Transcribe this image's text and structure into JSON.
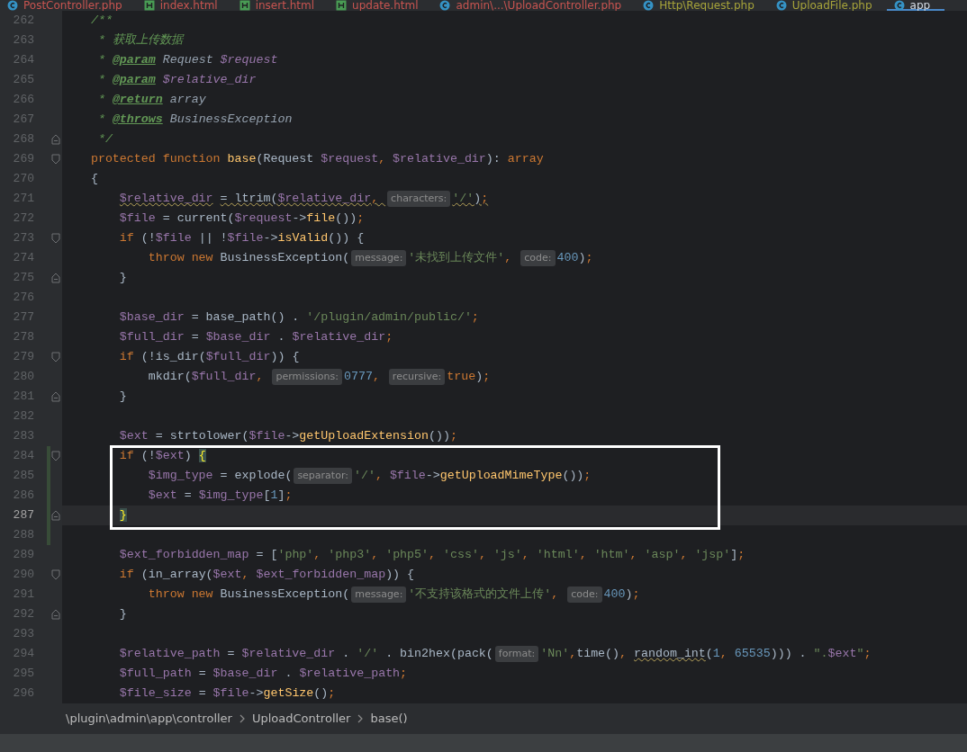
{
  "tabs": [
    {
      "label": "PostController.php",
      "kind": "php",
      "color": "#c75450",
      "selected": false
    },
    {
      "label": "index.html",
      "kind": "html",
      "color": "#c75450",
      "selected": false
    },
    {
      "label": "insert.html",
      "kind": "html",
      "color": "#c75450",
      "selected": false
    },
    {
      "label": "update.html",
      "kind": "html",
      "color": "#c75450",
      "selected": false
    },
    {
      "label": "admin\\...\\UploadController.php",
      "kind": "php",
      "color": "#c75450",
      "selected": false
    },
    {
      "label": "Http\\Request.php",
      "kind": "php",
      "color": "#a6a33a",
      "selected": false
    },
    {
      "label": "UploadFile.php",
      "kind": "php",
      "color": "#a6a33a",
      "selected": false
    },
    {
      "label": "app",
      "kind": "php",
      "color": "#d6dde6",
      "selected": true
    }
  ],
  "editor": {
    "lines": [
      {
        "number": "262",
        "tokens": [
          {
            "kind": "doc",
            "text": "    /**"
          }
        ]
      },
      {
        "number": "263",
        "tokens": [
          {
            "kind": "doc",
            "text": "     * 获取上传数据"
          }
        ]
      },
      {
        "number": "264",
        "tokens": [
          {
            "kind": "doc",
            "text": "     * "
          },
          {
            "kind": "tag",
            "text": "@param"
          },
          {
            "kind": "doctype",
            "text": " Request "
          },
          {
            "kind": "docvar",
            "text": "$request"
          }
        ]
      },
      {
        "number": "265",
        "tokens": [
          {
            "kind": "doc",
            "text": "     * "
          },
          {
            "kind": "tag",
            "text": "@param"
          },
          {
            "kind": "docvar",
            "text": " $relative_dir"
          }
        ]
      },
      {
        "number": "266",
        "tokens": [
          {
            "kind": "doc",
            "text": "     * "
          },
          {
            "kind": "tag",
            "text": "@return"
          },
          {
            "kind": "doctype",
            "text": " array"
          }
        ]
      },
      {
        "number": "267",
        "tokens": [
          {
            "kind": "doc",
            "text": "     * "
          },
          {
            "kind": "tag",
            "text": "@throws"
          },
          {
            "kind": "doctype",
            "text": " BusinessException"
          }
        ]
      },
      {
        "number": "268",
        "fold_end": true,
        "tokens": [
          {
            "kind": "doc",
            "text": "     */"
          }
        ]
      },
      {
        "number": "269",
        "fold_start": true,
        "tokens": [
          {
            "kind": "kw",
            "text": "    protected function "
          },
          {
            "kind": "fn",
            "text": "base"
          },
          {
            "kind": "plain",
            "text": "(Request "
          },
          {
            "kind": "var",
            "text": "$request"
          },
          {
            "kind": "kw",
            "text": ", "
          },
          {
            "kind": "var",
            "text": "$relative_dir"
          },
          {
            "kind": "plain",
            "text": "): "
          },
          {
            "kind": "kw",
            "text": "array"
          }
        ]
      },
      {
        "number": "270",
        "tokens": [
          {
            "kind": "plain",
            "text": "    {"
          }
        ]
      },
      {
        "number": "271",
        "tokens": [
          {
            "kind": "var",
            "text": "        $relative_dir",
            "warning": true
          },
          {
            "kind": "plain",
            "text": " = ltrim(",
            "warning": true
          },
          {
            "kind": "var",
            "text": "$relative_dir",
            "warning": true
          },
          {
            "kind": "kw",
            "text": ", ",
            "warning": true
          },
          {
            "kind": "hint",
            "text": "characters:"
          },
          {
            "kind": "str",
            "text": "'/'",
            "warning": true
          },
          {
            "kind": "plain",
            "text": ")",
            "warning": true
          },
          {
            "kind": "kw",
            "text": ";",
            "warning": true
          }
        ]
      },
      {
        "number": "272",
        "tokens": [
          {
            "kind": "var",
            "text": "        $file"
          },
          {
            "kind": "plain",
            "text": " = current("
          },
          {
            "kind": "var",
            "text": "$request"
          },
          {
            "kind": "plain",
            "text": "->"
          },
          {
            "kind": "fn",
            "text": "file"
          },
          {
            "kind": "plain",
            "text": "())"
          },
          {
            "kind": "kw",
            "text": ";"
          }
        ]
      },
      {
        "number": "273",
        "fold_start": true,
        "tokens": [
          {
            "kind": "kw",
            "text": "        if"
          },
          {
            "kind": "plain",
            "text": " (!"
          },
          {
            "kind": "var",
            "text": "$file"
          },
          {
            "kind": "plain",
            "text": " || !"
          },
          {
            "kind": "var",
            "text": "$file"
          },
          {
            "kind": "plain",
            "text": "->"
          },
          {
            "kind": "fn",
            "text": "isValid"
          },
          {
            "kind": "plain",
            "text": "()) {"
          }
        ]
      },
      {
        "number": "274",
        "tokens": [
          {
            "kind": "kw",
            "text": "            throw new "
          },
          {
            "kind": "plain",
            "text": "BusinessException("
          },
          {
            "kind": "hint",
            "text": "message:"
          },
          {
            "kind": "str",
            "text": "'未找到上传文件'"
          },
          {
            "kind": "kw",
            "text": ", "
          },
          {
            "kind": "hint",
            "text": "code:"
          },
          {
            "kind": "num",
            "text": "400"
          },
          {
            "kind": "plain",
            "text": ")"
          },
          {
            "kind": "kw",
            "text": ";"
          }
        ]
      },
      {
        "number": "275",
        "fold_end": true,
        "tokens": [
          {
            "kind": "plain",
            "text": "        }"
          }
        ]
      },
      {
        "number": "276"
      },
      {
        "number": "277",
        "tokens": [
          {
            "kind": "var",
            "text": "        $base_dir"
          },
          {
            "kind": "plain",
            "text": " = base_path() . "
          },
          {
            "kind": "str",
            "text": "'/plugin/admin/public/'"
          },
          {
            "kind": "kw",
            "text": ";"
          }
        ]
      },
      {
        "number": "278",
        "tokens": [
          {
            "kind": "var",
            "text": "        $full_dir"
          },
          {
            "kind": "plain",
            "text": " = "
          },
          {
            "kind": "var",
            "text": "$base_dir"
          },
          {
            "kind": "plain",
            "text": " . "
          },
          {
            "kind": "var",
            "text": "$relative_dir"
          },
          {
            "kind": "kw",
            "text": ";"
          }
        ]
      },
      {
        "number": "279",
        "fold_start": true,
        "tokens": [
          {
            "kind": "kw",
            "text": "        if"
          },
          {
            "kind": "plain",
            "text": " (!is_dir("
          },
          {
            "kind": "var",
            "text": "$full_dir"
          },
          {
            "kind": "plain",
            "text": ")) {"
          }
        ]
      },
      {
        "number": "280",
        "tokens": [
          {
            "kind": "plain",
            "text": "            mkdir("
          },
          {
            "kind": "var",
            "text": "$full_dir"
          },
          {
            "kind": "kw",
            "text": ", "
          },
          {
            "kind": "hint",
            "text": "permissions:"
          },
          {
            "kind": "num",
            "text": "0777"
          },
          {
            "kind": "kw",
            "text": ", "
          },
          {
            "kind": "hint",
            "text": "recursive:"
          },
          {
            "kind": "kw",
            "text": "true"
          },
          {
            "kind": "plain",
            "text": ")"
          },
          {
            "kind": "kw",
            "text": ";"
          }
        ]
      },
      {
        "number": "281",
        "fold_end": true,
        "tokens": [
          {
            "kind": "plain",
            "text": "        }"
          }
        ]
      },
      {
        "number": "282"
      },
      {
        "number": "283",
        "tokens": [
          {
            "kind": "var",
            "text": "        $ext"
          },
          {
            "kind": "plain",
            "text": " = strtolower("
          },
          {
            "kind": "var",
            "text": "$file"
          },
          {
            "kind": "plain",
            "text": "->"
          },
          {
            "kind": "fn",
            "text": "getUploadExtension"
          },
          {
            "kind": "plain",
            "text": "())"
          },
          {
            "kind": "kw",
            "text": ";"
          }
        ]
      },
      {
        "number": "284",
        "fold_start": true,
        "changed": true,
        "boxed": true,
        "tokens": [
          {
            "kind": "kw",
            "text": "        if"
          },
          {
            "kind": "plain",
            "text": " (!"
          },
          {
            "kind": "var",
            "text": "$ext"
          },
          {
            "kind": "plain",
            "text": ") "
          },
          {
            "kind": "brace",
            "text": "{"
          }
        ]
      },
      {
        "number": "285",
        "changed": true,
        "boxed": true,
        "tokens": [
          {
            "kind": "var",
            "text": "            $img_type"
          },
          {
            "kind": "plain",
            "text": " = explode("
          },
          {
            "kind": "hint",
            "text": "separator:"
          },
          {
            "kind": "str",
            "text": "'/'"
          },
          {
            "kind": "kw",
            "text": ", "
          },
          {
            "kind": "var",
            "text": "$file"
          },
          {
            "kind": "plain",
            "text": "->"
          },
          {
            "kind": "fn",
            "text": "getUploadMimeType"
          },
          {
            "kind": "plain",
            "text": "())"
          },
          {
            "kind": "kw",
            "text": ";"
          }
        ]
      },
      {
        "number": "286",
        "changed": true,
        "boxed": true,
        "tokens": [
          {
            "kind": "var",
            "text": "            $ext"
          },
          {
            "kind": "plain",
            "text": " = "
          },
          {
            "kind": "var",
            "text": "$img_type"
          },
          {
            "kind": "plain",
            "text": "["
          },
          {
            "kind": "num",
            "text": "1"
          },
          {
            "kind": "plain",
            "text": "]"
          },
          {
            "kind": "kw",
            "text": ";"
          }
        ]
      },
      {
        "number": "287",
        "fold_end": true,
        "changed": true,
        "boxed": true,
        "current": true,
        "tokens": [
          {
            "kind": "brace",
            "text": "        }"
          }
        ]
      },
      {
        "number": "288",
        "changed": true
      },
      {
        "number": "289",
        "tokens": [
          {
            "kind": "var",
            "text": "        $ext_forbidden_map"
          },
          {
            "kind": "plain",
            "text": " = ["
          },
          {
            "kind": "str",
            "text": "'php'"
          },
          {
            "kind": "kw",
            "text": ", "
          },
          {
            "kind": "str",
            "text": "'php3'"
          },
          {
            "kind": "kw",
            "text": ", "
          },
          {
            "kind": "str",
            "text": "'php5'"
          },
          {
            "kind": "kw",
            "text": ", "
          },
          {
            "kind": "str",
            "text": "'css'"
          },
          {
            "kind": "kw",
            "text": ", "
          },
          {
            "kind": "str",
            "text": "'js'"
          },
          {
            "kind": "kw",
            "text": ", "
          },
          {
            "kind": "str",
            "text": "'html'"
          },
          {
            "kind": "kw",
            "text": ", "
          },
          {
            "kind": "str",
            "text": "'htm'"
          },
          {
            "kind": "kw",
            "text": ", "
          },
          {
            "kind": "str",
            "text": "'asp'"
          },
          {
            "kind": "kw",
            "text": ", "
          },
          {
            "kind": "str",
            "text": "'jsp'"
          },
          {
            "kind": "plain",
            "text": "]"
          },
          {
            "kind": "kw",
            "text": ";"
          }
        ]
      },
      {
        "number": "290",
        "fold_start": true,
        "tokens": [
          {
            "kind": "kw",
            "text": "        if"
          },
          {
            "kind": "plain",
            "text": " (in_array("
          },
          {
            "kind": "var",
            "text": "$ext"
          },
          {
            "kind": "kw",
            "text": ", "
          },
          {
            "kind": "var",
            "text": "$ext_forbidden_map"
          },
          {
            "kind": "plain",
            "text": ")) {"
          }
        ]
      },
      {
        "number": "291",
        "tokens": [
          {
            "kind": "kw",
            "text": "            throw new "
          },
          {
            "kind": "plain",
            "text": "BusinessException("
          },
          {
            "kind": "hint",
            "text": "message:"
          },
          {
            "kind": "str",
            "text": "'不支持该格式的文件上传'"
          },
          {
            "kind": "kw",
            "text": ", "
          },
          {
            "kind": "hint",
            "text": "code:"
          },
          {
            "kind": "num",
            "text": "400"
          },
          {
            "kind": "plain",
            "text": ")"
          },
          {
            "kind": "kw",
            "text": ";"
          }
        ]
      },
      {
        "number": "292",
        "fold_end": true,
        "tokens": [
          {
            "kind": "plain",
            "text": "        }"
          }
        ]
      },
      {
        "number": "293"
      },
      {
        "number": "294",
        "tokens": [
          {
            "kind": "var",
            "text": "        $relative_path"
          },
          {
            "kind": "plain",
            "text": " = "
          },
          {
            "kind": "var",
            "text": "$relative_dir"
          },
          {
            "kind": "plain",
            "text": " . "
          },
          {
            "kind": "str",
            "text": "'/'"
          },
          {
            "kind": "plain",
            "text": " . bin2hex(pack("
          },
          {
            "kind": "hint",
            "text": "format:"
          },
          {
            "kind": "str",
            "text": "'Nn'"
          },
          {
            "kind": "kw",
            "text": ","
          },
          {
            "kind": "plain",
            "text": "time()"
          },
          {
            "kind": "kw",
            "text": ", "
          },
          {
            "kind": "plain",
            "text": "random_int",
            "warning": true
          },
          {
            "kind": "plain",
            "text": "("
          },
          {
            "kind": "num",
            "text": "1"
          },
          {
            "kind": "kw",
            "text": ", "
          },
          {
            "kind": "num",
            "text": "65535"
          },
          {
            "kind": "plain",
            "text": "))) . "
          },
          {
            "kind": "str",
            "text": "\"."
          },
          {
            "kind": "var",
            "text": "$ext"
          },
          {
            "kind": "str",
            "text": "\""
          },
          {
            "kind": "kw",
            "text": ";"
          }
        ]
      },
      {
        "number": "295",
        "tokens": [
          {
            "kind": "var",
            "text": "        $full_path"
          },
          {
            "kind": "plain",
            "text": " = "
          },
          {
            "kind": "var",
            "text": "$base_dir"
          },
          {
            "kind": "plain",
            "text": " . "
          },
          {
            "kind": "var",
            "text": "$relative_path"
          },
          {
            "kind": "kw",
            "text": ";"
          }
        ]
      },
      {
        "number": "296",
        "tokens": [
          {
            "kind": "var",
            "text": "        $file_size"
          },
          {
            "kind": "plain",
            "text": " = "
          },
          {
            "kind": "var",
            "text": "$file"
          },
          {
            "kind": "plain",
            "text": "->"
          },
          {
            "kind": "fn",
            "text": "getSize"
          },
          {
            "kind": "plain",
            "text": "()"
          },
          {
            "kind": "kw",
            "text": ";"
          }
        ]
      }
    ]
  },
  "breadcrumb": [
    "\\plugin\\admin\\app\\controller",
    "UploadController",
    "base()"
  ]
}
